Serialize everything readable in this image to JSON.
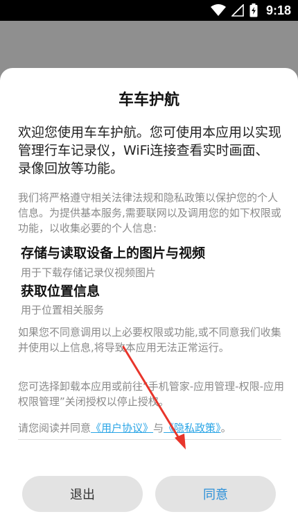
{
  "status_bar": {
    "time": "9:18",
    "icons": [
      "wifi-icon",
      "signal-icon",
      "battery-charging-icon"
    ]
  },
  "dialog": {
    "title": "车车护航",
    "intro": "欢迎您使用车车护航。您可使用本应用以实现管理行车记录仪，WiFi连接查看实时画面、录像回放等功能。",
    "notice": "我们将严格遵守相关法律法规和隐私政策以保护您的个人信息。为提供基本服务,需要联网以及调用您的如下权限或功能，以收集必要的个人信息:",
    "permissions": [
      {
        "title": "存储与读取设备上的图片与视频",
        "desc": "用于下载存储记录仪视频图片"
      },
      {
        "title": "获取位置信息",
        "desc": "用于位置相关服务"
      }
    ],
    "disagree_note": "如果您不同意调用以上必要权限或功能,或不同意我们收集并使用以上信息,将导致本应用无法正常运行。",
    "uninstall_note": "您可选择卸载本应用或前往“手机管家-应用管理-权限-应用权限管理”关闭授权以停止授权。",
    "consent": {
      "prefix": "请您阅读并同意",
      "user_agreement": "《用户协议》",
      "connector": "与",
      "privacy_policy": "《隐私政策》",
      "suffix": "。"
    },
    "buttons": {
      "exit": "退出",
      "agree": "同意"
    }
  },
  "colors": {
    "link": "#2aa5e6",
    "agree_text": "#2a8fd8",
    "annotation_arrow": "#e8352b"
  }
}
